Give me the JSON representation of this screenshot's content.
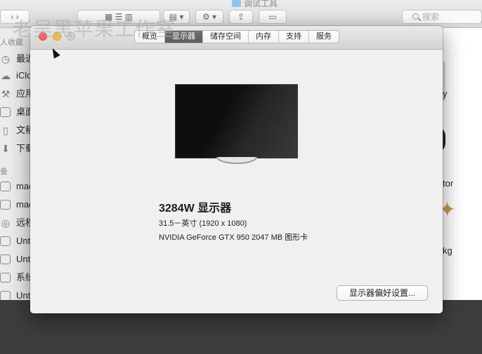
{
  "finder": {
    "title": "调试工具",
    "search_placeholder": "搜索",
    "sidebar": {
      "favorites_header": "人收藏",
      "devices_header": "备",
      "items": [
        {
          "label": "最近",
          "icon": "clock-icon"
        },
        {
          "label": "iClou",
          "icon": "cloud-icon"
        },
        {
          "label": "应用",
          "icon": "applications-icon"
        },
        {
          "label": "桌面",
          "icon": "desktop-icon"
        },
        {
          "label": "文稿",
          "icon": "document-icon"
        },
        {
          "label": "下载",
          "icon": "download-icon"
        },
        {
          "label": "mac",
          "icon": "computer-icon"
        },
        {
          "label": "mac",
          "icon": "disk-icon"
        },
        {
          "label": "远程",
          "icon": "remote-disc-icon"
        },
        {
          "label": "Unt",
          "icon": "disk-icon"
        },
        {
          "label": "Unt",
          "icon": "disk-icon"
        },
        {
          "label": "系统",
          "icon": "disk-icon"
        },
        {
          "label": "Unt",
          "icon": "disk-icon"
        }
      ]
    },
    "right_labels": [
      "y",
      "tor",
      "kg"
    ]
  },
  "about": {
    "tabs": [
      {
        "label": "概览",
        "active": false
      },
      {
        "label": "显示器",
        "active": true
      },
      {
        "label": "储存空间",
        "active": false
      },
      {
        "label": "内存",
        "active": false
      },
      {
        "label": "支持",
        "active": false
      },
      {
        "label": "服务",
        "active": false
      }
    ],
    "display_name": "3284W 显示器",
    "display_size": "31.5－英寸 (1920 x 1080)",
    "gpu": "NVIDIA GeForce GTX 950 2047 MB 图形卡",
    "prefs_button": "显示器偏好设置..."
  },
  "watermark": "老吴黑苹果工作室",
  "colors": {
    "close": "#fc605c",
    "minimize": "#fdbc40",
    "zoom": "#cfcfcf",
    "active_tab": "#636363"
  }
}
